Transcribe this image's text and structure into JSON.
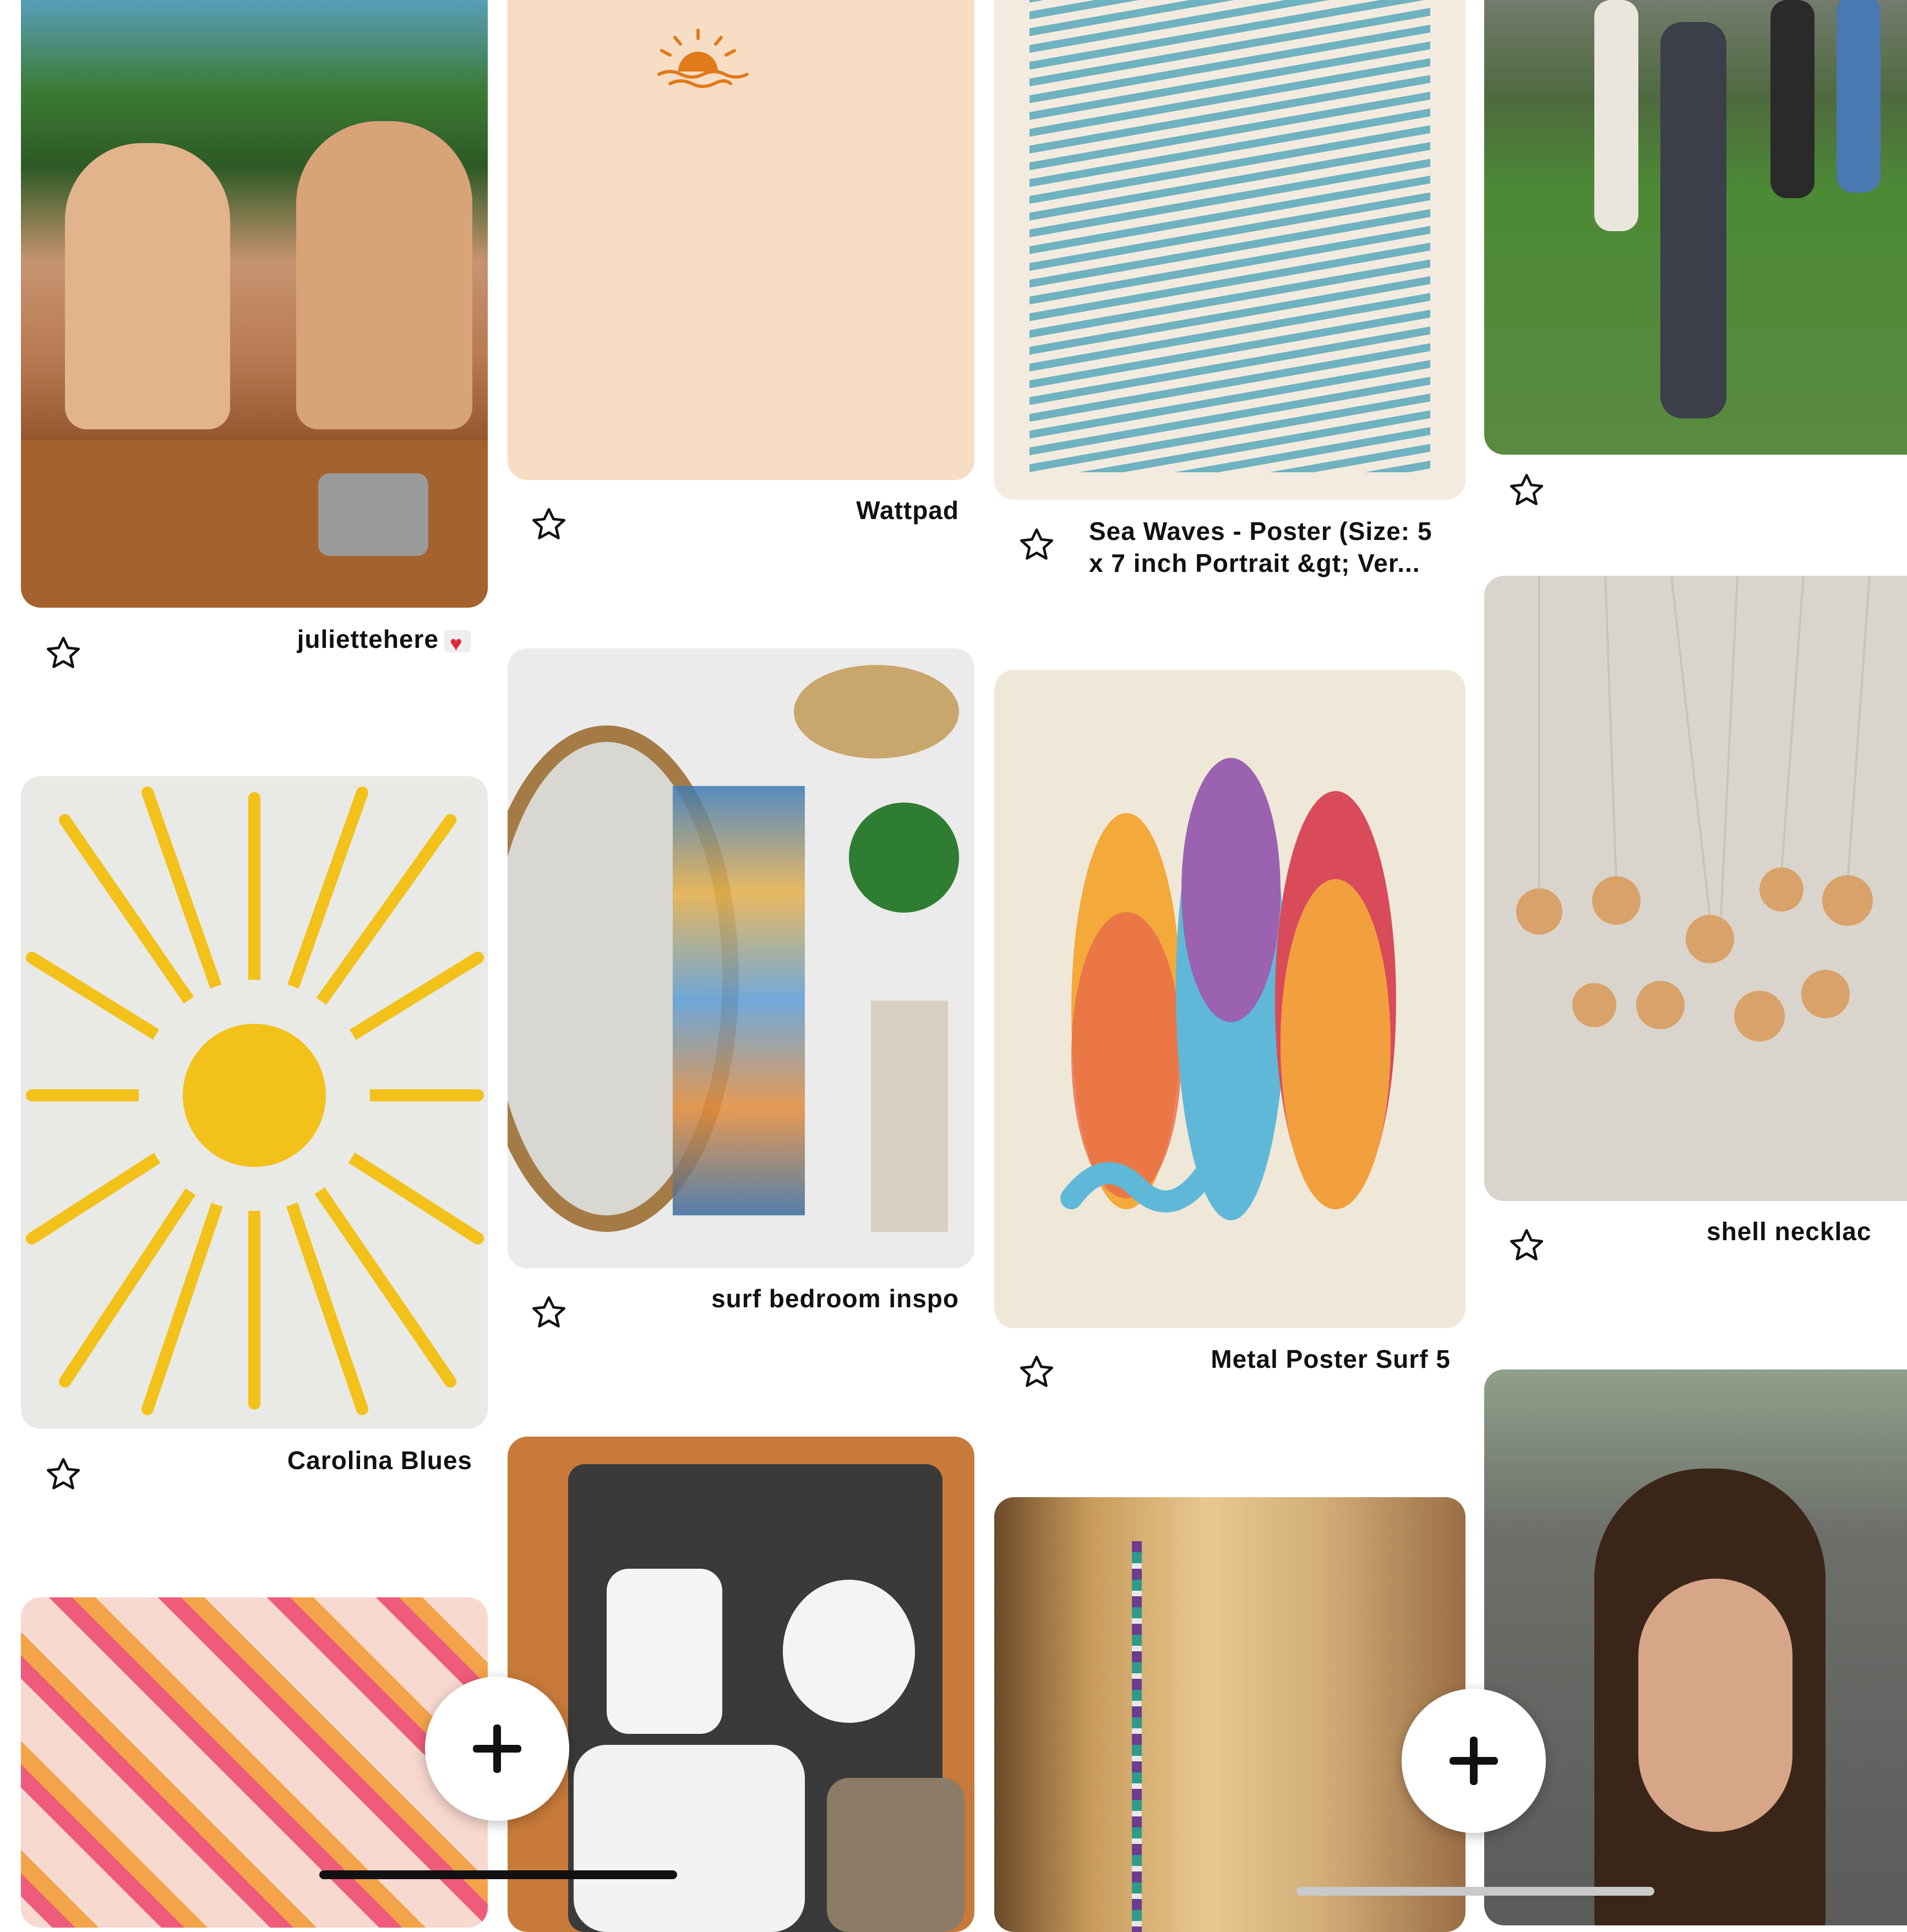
{
  "pins": [
    {
      "caption": "juliettehere",
      "has_heart": true
    },
    {
      "caption": "Wattpad"
    },
    {
      "caption": "Sea Waves - Poster (Size: 5 x 7 inch Portrait  &gt;  Ver..."
    },
    {
      "caption": ""
    },
    {
      "caption": "Carolina Blues"
    },
    {
      "caption": "surf bedroom inspo"
    },
    {
      "caption": "Metal Poster Surf 5"
    },
    {
      "caption": "shell necklac"
    },
    {
      "caption": ""
    },
    {
      "caption": ""
    },
    {
      "caption": ""
    },
    {
      "caption": ""
    }
  ],
  "icons": {
    "save": "star-outline-icon",
    "add": "plus-icon"
  }
}
